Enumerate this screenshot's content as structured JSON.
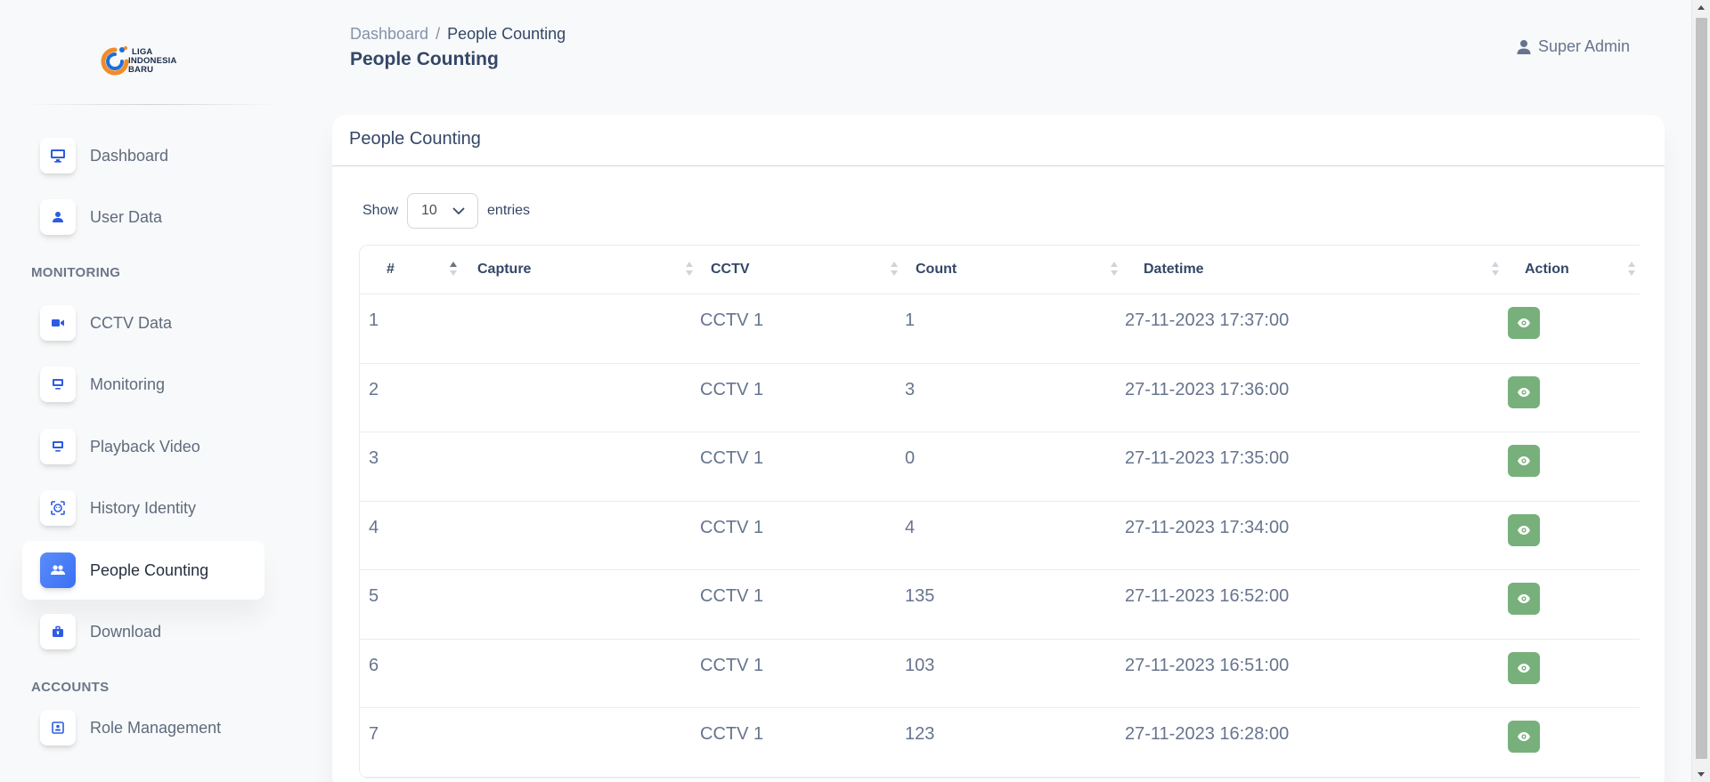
{
  "logo": {
    "line1": "LIGA",
    "line2": "INDONESIA",
    "line3": "BARU"
  },
  "sidebar": {
    "items": [
      {
        "label": "Dashboard",
        "icon": "monitor-icon"
      },
      {
        "label": "User Data",
        "icon": "user-icon"
      },
      {
        "label": "CCTV Data",
        "icon": "video-camera-icon"
      },
      {
        "label": "Monitoring",
        "icon": "monitor-icon"
      },
      {
        "label": "Playback Video",
        "icon": "monitor-icon"
      },
      {
        "label": "History Identity",
        "icon": "face-scan-icon"
      },
      {
        "label": "People Counting",
        "icon": "users-icon",
        "active": true
      },
      {
        "label": "Download",
        "icon": "toolbox-icon"
      },
      {
        "label": "Role Management",
        "icon": "id-card-icon"
      }
    ],
    "sections": {
      "monitoring": "MONITORING",
      "accounts": "ACCOUNTS"
    }
  },
  "header": {
    "breadcrumb_root": "Dashboard",
    "breadcrumb_sep": "/",
    "breadcrumb_current": "People Counting",
    "title": "People Counting",
    "user": "Super Admin"
  },
  "card": {
    "title": "People Counting",
    "show_label": "Show",
    "entries_label": "entries",
    "page_size": "10"
  },
  "table": {
    "columns": [
      "#",
      "Capture",
      "CCTV",
      "Count",
      "Datetime",
      "Action"
    ],
    "rows": [
      {
        "no": "1",
        "capture": "",
        "cctv": "CCTV 1",
        "count": "1",
        "datetime": "27-11-2023 17:37:00"
      },
      {
        "no": "2",
        "capture": "",
        "cctv": "CCTV 1",
        "count": "3",
        "datetime": "27-11-2023 17:36:00"
      },
      {
        "no": "3",
        "capture": "",
        "cctv": "CCTV 1",
        "count": "0",
        "datetime": "27-11-2023 17:35:00"
      },
      {
        "no": "4",
        "capture": "",
        "cctv": "CCTV 1",
        "count": "4",
        "datetime": "27-11-2023 17:34:00"
      },
      {
        "no": "5",
        "capture": "",
        "cctv": "CCTV 1",
        "count": "135",
        "datetime": "27-11-2023 16:52:00"
      },
      {
        "no": "6",
        "capture": "",
        "cctv": "CCTV 1",
        "count": "103",
        "datetime": "27-11-2023 16:51:00"
      },
      {
        "no": "7",
        "capture": "",
        "cctv": "CCTV 1",
        "count": "123",
        "datetime": "27-11-2023 16:28:00"
      }
    ]
  },
  "colors": {
    "accent": "#3a6ff5",
    "action_button": "#78b07c",
    "text_primary": "#344767",
    "text_muted": "#67748e"
  }
}
